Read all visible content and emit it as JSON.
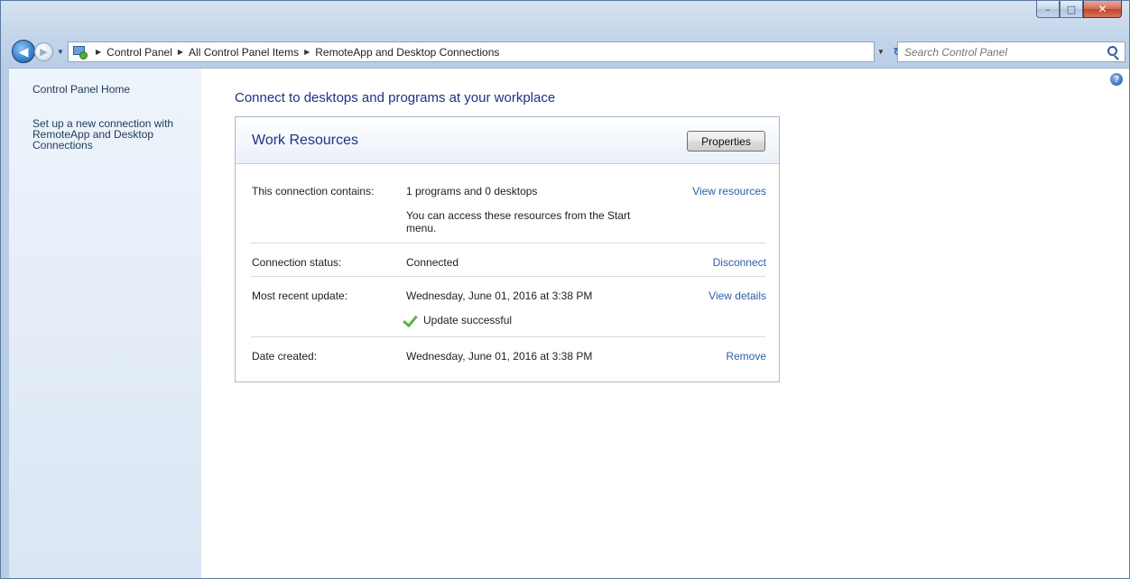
{
  "window": {
    "caption": {
      "minimize": "–",
      "maximize": "□",
      "close": "✕"
    }
  },
  "address_bar": {
    "breadcrumbs": [
      "Control Panel",
      "All Control Panel Items",
      "RemoteApp and Desktop Connections"
    ],
    "separator": "▶"
  },
  "search": {
    "placeholder": "Search Control Panel"
  },
  "sidebar": {
    "home": "Control Panel Home",
    "setup": "Set up a new connection with RemoteApp and Desktop Connections"
  },
  "page": {
    "title": "Connect to desktops and programs at your workplace"
  },
  "card": {
    "title": "Work Resources",
    "properties_button": "Properties",
    "rows": [
      {
        "label": "This connection contains:",
        "value": "1 programs and 0 desktops",
        "note": "You can access these resources from the Start menu.",
        "action": "View resources"
      },
      {
        "label": "Connection status:",
        "value": "Connected",
        "action": "Disconnect"
      },
      {
        "label": "Most recent update:",
        "value": "Wednesday, June 01, 2016 at 3:38 PM",
        "note": "Update successful",
        "action": "View details"
      },
      {
        "label": "Date created:",
        "value": "Wednesday, June 01, 2016 at 3:38 PM",
        "action": "Remove"
      }
    ]
  },
  "icons": {
    "back": "back-arrow-icon",
    "forward": "forward-arrow-icon",
    "location": "remoteapp-icon",
    "refresh": "refresh-icon",
    "search": "search-icon",
    "help": "help-icon",
    "check": "green-check-icon"
  },
  "colors": {
    "link": "#2e5ea8",
    "title": "#1e3287",
    "sidebar_link": "#1e395b",
    "success": "#5cb34a"
  }
}
